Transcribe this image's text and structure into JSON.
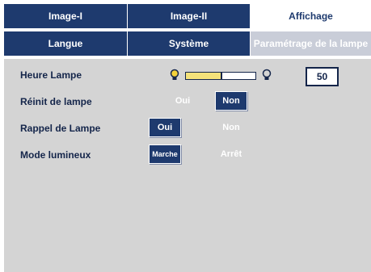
{
  "tabs_row1": [
    "Image-I",
    "Image-II",
    "Affichage"
  ],
  "tabs_row2": [
    "Langue",
    "Système",
    "Paramétrage de la lampe"
  ],
  "settings": {
    "lamp_hours": {
      "label": "Heure Lampe",
      "value": "50",
      "level": 0.5
    },
    "lamp_reset": {
      "label": "Réinit de lampe",
      "options": [
        "Oui",
        "Non"
      ],
      "selected": "Non"
    },
    "lamp_reminder": {
      "label": "Rappel de Lampe",
      "options": [
        "Oui",
        "Non"
      ],
      "selected": "Oui"
    },
    "brightness_mode": {
      "label": "Mode lumineux",
      "options": [
        "Marche",
        "Arrêt"
      ],
      "selected": "Marche"
    }
  },
  "colors": {
    "tab_bg": "#1e3a6e",
    "panel_bg": "#d4d4d4",
    "slider_fill": "#f4e27a"
  }
}
